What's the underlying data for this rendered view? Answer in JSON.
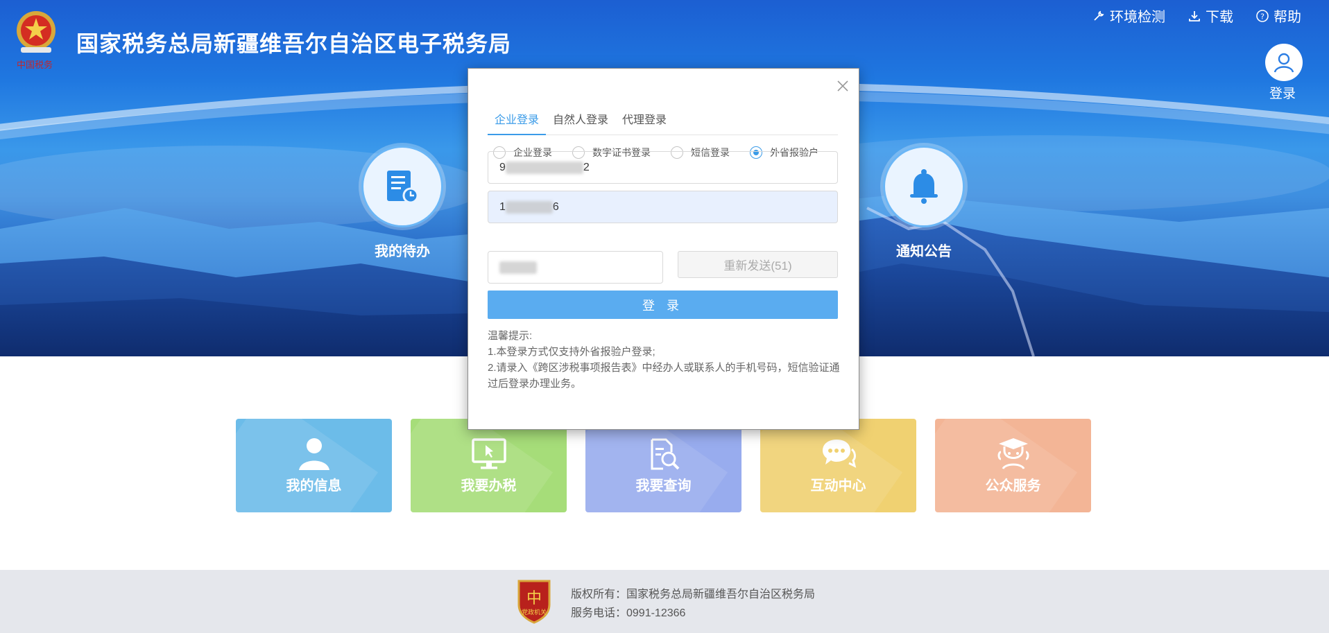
{
  "header": {
    "site_title": "国家税务总局新疆维吾尔自治区电子税务局",
    "links": [
      {
        "label": "环境检测",
        "icon": "wrench-icon"
      },
      {
        "label": "下载",
        "icon": "download-icon"
      },
      {
        "label": "帮助",
        "icon": "help-icon"
      }
    ],
    "login_label": "登录"
  },
  "features": {
    "todo": {
      "label": "我的待办",
      "icon": "todo-document-icon"
    },
    "notice": {
      "label": "通知公告",
      "icon": "bell-icon"
    }
  },
  "tiles": [
    {
      "label": "我的信息",
      "icon": "user-icon",
      "color": "#6cbce9"
    },
    {
      "label": "我要办税",
      "icon": "monitor-icon",
      "color": "#a6dd79"
    },
    {
      "label": "我要查询",
      "icon": "document-search-icon",
      "color": "#98acee"
    },
    {
      "label": "互动中心",
      "icon": "chat-bubble-icon",
      "color": "#f0d171"
    },
    {
      "label": "公众服务",
      "icon": "service-agent-icon",
      "color": "#f3b596"
    }
  ],
  "modal": {
    "tabs": [
      "企业登录",
      "自然人登录",
      "代理登录"
    ],
    "active_tab": "企业登录",
    "radios": [
      "企业登录",
      "数字证书登录",
      "短信登录",
      "外省报验户"
    ],
    "selected_radio": "外省报验户",
    "taxpayer_id_visible_start": "9",
    "taxpayer_id_visible_end": "2",
    "phone_visible_start": "1",
    "phone_visible_end": "6",
    "resend_label": "重新发送(51)",
    "login_button": "登 录",
    "tips_title": "温馨提示:",
    "tips": [
      "1.本登录方式仅支持外省报验户登录;",
      "2.请录入《跨区涉税事项报告表》中经办人或联系人的手机号码，短信验证通过后登录办理业务。"
    ]
  },
  "footer": {
    "copyright": "版权所有：国家税务总局新疆维吾尔自治区税务局",
    "phone": "服务电话：0991-12366",
    "badge_text": "党政机关"
  },
  "colors": {
    "accent": "#3a9be8",
    "login_button": "#5aacf0",
    "footer_bg": "#e5e7ec"
  }
}
